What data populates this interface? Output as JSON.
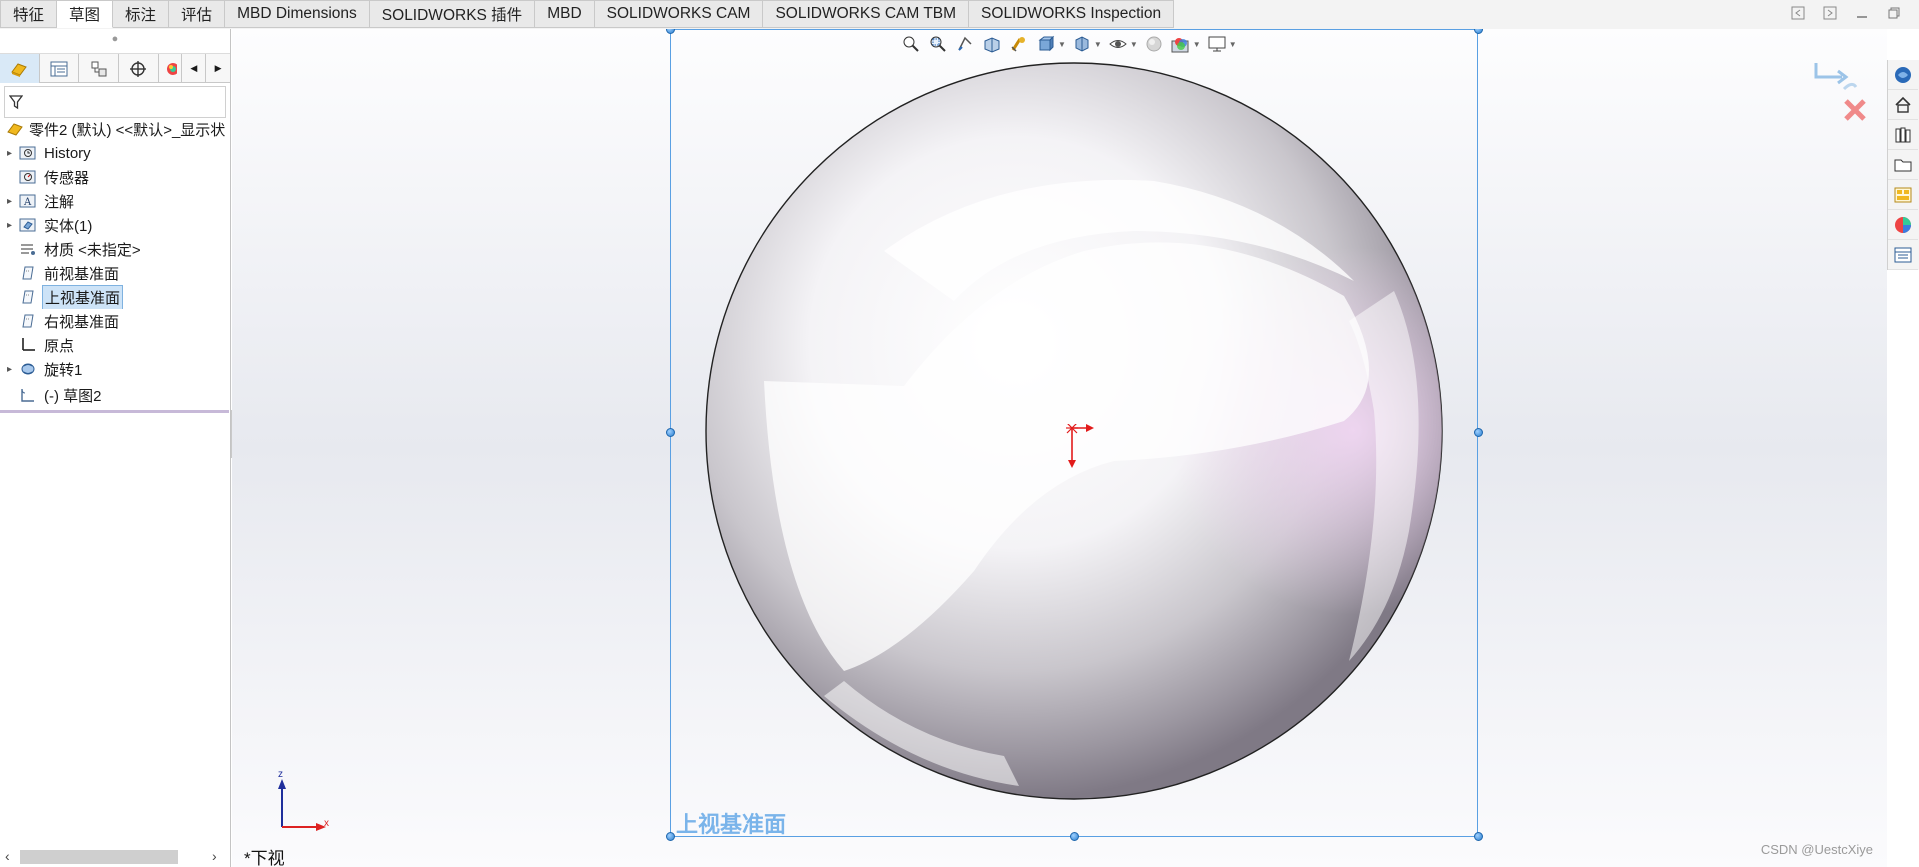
{
  "tabs": [
    {
      "label": "特征",
      "active": false
    },
    {
      "label": "草图",
      "active": true
    },
    {
      "label": "标注",
      "active": false
    },
    {
      "label": "评估",
      "active": false
    },
    {
      "label": "MBD Dimensions",
      "active": false
    },
    {
      "label": "SOLIDWORKS 插件",
      "active": false
    },
    {
      "label": "MBD",
      "active": false
    },
    {
      "label": "SOLIDWORKS CAM",
      "active": false
    },
    {
      "label": "SOLIDWORKS CAM TBM",
      "active": false
    },
    {
      "label": "SOLIDWORKS Inspection",
      "active": false
    }
  ],
  "window_controls": [
    "restore-left-icon",
    "restore-right-icon",
    "minimize-icon",
    "maximize-icon"
  ],
  "feature_tree": {
    "root": "零件2 (默认) <<默认>_显示状",
    "items": [
      {
        "label": "History",
        "icon": "history-folder-icon",
        "expandable": true
      },
      {
        "label": "传感器",
        "icon": "sensor-icon",
        "expandable": false
      },
      {
        "label": "注解",
        "icon": "annotation-icon",
        "expandable": true
      },
      {
        "label": "实体(1)",
        "icon": "solid-bodies-icon",
        "expandable": true
      },
      {
        "label": "材质 <未指定>",
        "icon": "material-icon",
        "expandable": false
      },
      {
        "label": "前视基准面",
        "icon": "plane-icon",
        "expandable": false
      },
      {
        "label": "上视基准面",
        "icon": "plane-icon",
        "expandable": false,
        "selected": true
      },
      {
        "label": "右视基准面",
        "icon": "plane-icon",
        "expandable": false
      },
      {
        "label": "原点",
        "icon": "origin-icon",
        "expandable": false
      },
      {
        "label": "旋转1",
        "icon": "revolve-icon",
        "expandable": true
      },
      {
        "label": "(-) 草图2",
        "icon": "sketch-icon",
        "expandable": false
      }
    ]
  },
  "viewport": {
    "plane_label": "上视基准面",
    "view_orientation": "*下视",
    "triad": {
      "z": "z",
      "x": "x"
    },
    "watermark": "CSDN @UestcXiye"
  },
  "colors": {
    "accent": "#5aa0e3",
    "selection": "#cde3f7",
    "origin_red": "#e21b1b"
  }
}
